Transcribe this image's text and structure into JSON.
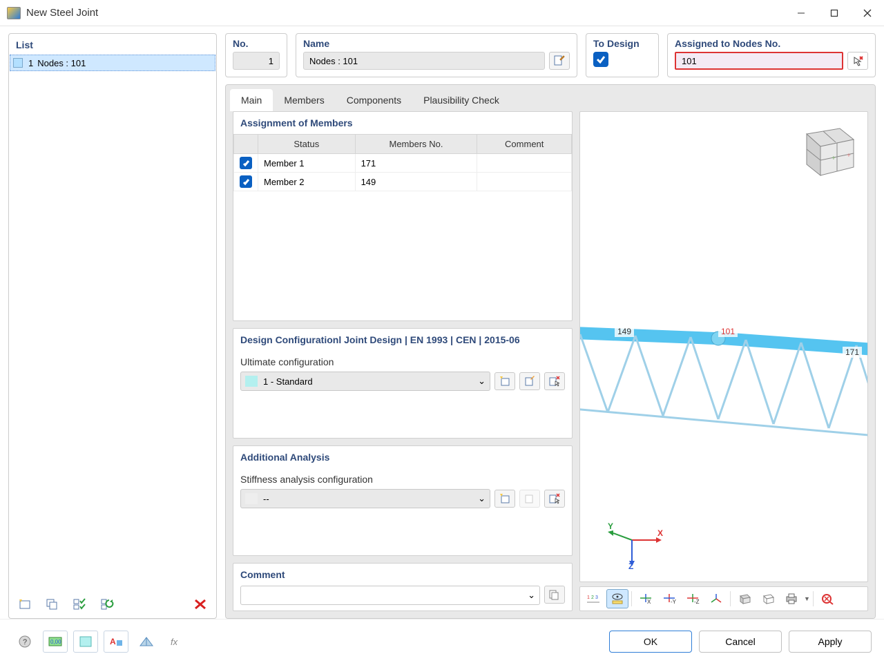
{
  "window": {
    "title": "New Steel Joint"
  },
  "list": {
    "header": "List",
    "items": [
      {
        "num": "1",
        "text": "Nodes : 101"
      }
    ]
  },
  "top": {
    "no": {
      "header": "No.",
      "value": "1"
    },
    "name": {
      "header": "Name",
      "value": "Nodes : 101"
    },
    "design": {
      "header": "To Design",
      "checked": true
    },
    "assigned": {
      "header": "Assigned to Nodes No.",
      "value": "101"
    }
  },
  "tabs": [
    "Main",
    "Members",
    "Components",
    "Plausibility Check"
  ],
  "sections": {
    "members": {
      "header": "Assignment of Members",
      "columns": [
        "Status",
        "Members No.",
        "Comment"
      ],
      "rows": [
        {
          "checked": true,
          "status": "Member 1",
          "no": "171",
          "comment": ""
        },
        {
          "checked": true,
          "status": "Member 2",
          "no": "149",
          "comment": ""
        }
      ]
    },
    "config": {
      "header": "Design Configurationl Joint Design | EN 1993 | CEN | 2015-06",
      "label": "Ultimate configuration",
      "value": "1 - Standard"
    },
    "analysis": {
      "header": "Additional Analysis",
      "label": "Stiffness analysis configuration",
      "value": "--"
    },
    "comment": {
      "header": "Comment",
      "value": ""
    }
  },
  "viewport": {
    "node_label": "101",
    "member_labels": [
      "149",
      "171"
    ],
    "axes": {
      "x": "X",
      "y": "Y",
      "z": "Z"
    }
  },
  "footer": {
    "ok": "OK",
    "cancel": "Cancel",
    "apply": "Apply"
  }
}
